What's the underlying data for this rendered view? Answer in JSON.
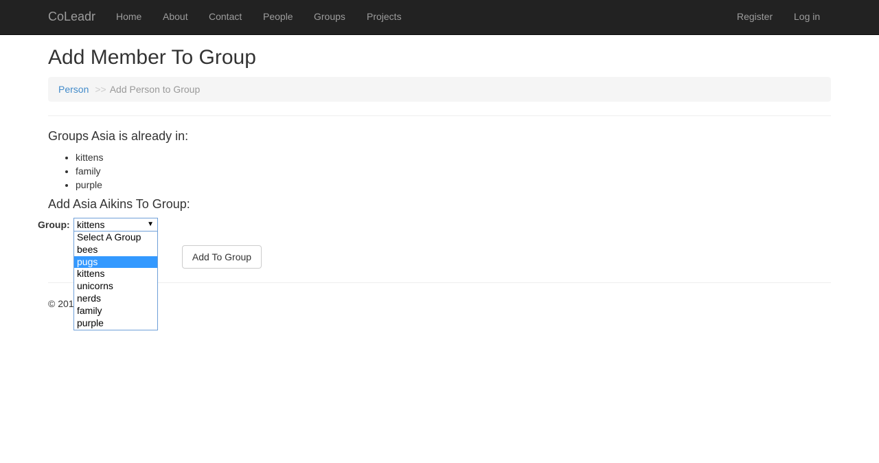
{
  "nav": {
    "brand": "CoLeadr",
    "links": [
      "Home",
      "About",
      "Contact",
      "People",
      "Groups",
      "Projects"
    ],
    "right": [
      "Register",
      "Log in"
    ]
  },
  "page_title": "Add Member To Group",
  "breadcrumb": {
    "link": "Person",
    "sep": ">>",
    "current": "Add Person to Group"
  },
  "existing_heading": "Groups Asia is already in:",
  "existing_groups": [
    "kittens",
    "family",
    "purple"
  ],
  "add_heading": "Add Asia Aikins To Group:",
  "form": {
    "label": "Group:",
    "selected_value": "kittens",
    "options": [
      "Select A Group",
      "bees",
      "pugs",
      "kittens",
      "unicorns",
      "nerds",
      "family",
      "purple"
    ],
    "highlighted_option": "pugs",
    "submit_label": "Add To Group"
  },
  "footer": {
    "text": "© 201"
  },
  "colors": {
    "navbar": "#222222",
    "link": "#428bca",
    "highlight": "#3399ff"
  }
}
